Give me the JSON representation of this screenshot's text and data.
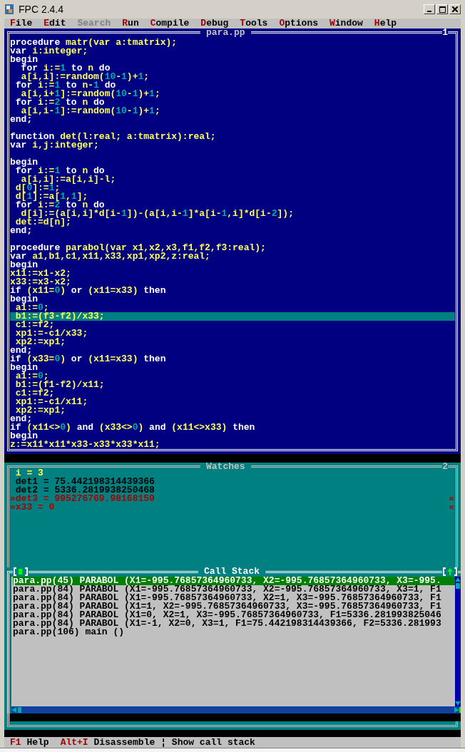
{
  "window": {
    "title": "FPC 2.4.4"
  },
  "menu": [
    {
      "hot": "F",
      "rest": "ile",
      "disabled": false
    },
    {
      "hot": "E",
      "rest": "dit",
      "disabled": false
    },
    {
      "hot": "S",
      "rest": "earch",
      "disabled": true
    },
    {
      "hot": "R",
      "rest": "un",
      "disabled": false
    },
    {
      "hot": "C",
      "rest": "ompile",
      "disabled": false
    },
    {
      "hot": "D",
      "rest": "ebug",
      "disabled": false
    },
    {
      "hot": "T",
      "rest": "ools",
      "disabled": false
    },
    {
      "hot": "O",
      "rest": "ptions",
      "disabled": false
    },
    {
      "hot": "W",
      "rest": "indow",
      "disabled": false
    },
    {
      "hot": "H",
      "rest": "elp",
      "disabled": false
    }
  ],
  "editor": {
    "title": "para.pp",
    "number": "1",
    "lines": [
      {
        "current": false,
        "seg": [
          {
            "kind": "keyword",
            "t": "procedure "
          },
          {
            "kind": "identifier",
            "t": "matr(var a:tmatrix);"
          }
        ]
      },
      {
        "current": false,
        "seg": [
          {
            "kind": "keyword",
            "t": "var "
          },
          {
            "kind": "identifier",
            "t": "i:integer;"
          }
        ]
      },
      {
        "current": false,
        "seg": [
          {
            "kind": "keyword",
            "t": "begin"
          }
        ]
      },
      {
        "current": false,
        "seg": [
          {
            "kind": "keyword",
            "t": "  for "
          },
          {
            "kind": "identifier",
            "t": "i:="
          },
          {
            "kind": "number",
            "t": "1"
          },
          {
            "kind": "keyword",
            "t": " to "
          },
          {
            "kind": "identifier",
            "t": "n"
          },
          {
            "kind": "keyword",
            "t": " do"
          }
        ]
      },
      {
        "current": false,
        "seg": [
          {
            "kind": "identifier",
            "t": "  a[i,i]:=random("
          },
          {
            "kind": "number",
            "t": "10"
          },
          {
            "kind": "identifier",
            "t": "-"
          },
          {
            "kind": "number",
            "t": "1"
          },
          {
            "kind": "identifier",
            "t": ")+"
          },
          {
            "kind": "number",
            "t": "1"
          },
          {
            "kind": "identifier",
            "t": ";"
          }
        ]
      },
      {
        "current": false,
        "seg": [
          {
            "kind": "keyword",
            "t": " for "
          },
          {
            "kind": "identifier",
            "t": "i:="
          },
          {
            "kind": "number",
            "t": "1"
          },
          {
            "kind": "keyword",
            "t": " to "
          },
          {
            "kind": "identifier",
            "t": "n-"
          },
          {
            "kind": "number",
            "t": "1"
          },
          {
            "kind": "keyword",
            "t": " do"
          }
        ]
      },
      {
        "current": false,
        "seg": [
          {
            "kind": "identifier",
            "t": "  a[i,i+"
          },
          {
            "kind": "number",
            "t": "1"
          },
          {
            "kind": "identifier",
            "t": "]:=random("
          },
          {
            "kind": "number",
            "t": "10"
          },
          {
            "kind": "identifier",
            "t": "-"
          },
          {
            "kind": "number",
            "t": "1"
          },
          {
            "kind": "identifier",
            "t": ")+"
          },
          {
            "kind": "number",
            "t": "1"
          },
          {
            "kind": "identifier",
            "t": ";"
          }
        ]
      },
      {
        "current": false,
        "seg": [
          {
            "kind": "keyword",
            "t": " for "
          },
          {
            "kind": "identifier",
            "t": "i:="
          },
          {
            "kind": "number",
            "t": "2"
          },
          {
            "kind": "keyword",
            "t": " to "
          },
          {
            "kind": "identifier",
            "t": "n"
          },
          {
            "kind": "keyword",
            "t": " do"
          }
        ]
      },
      {
        "current": false,
        "seg": [
          {
            "kind": "identifier",
            "t": "  a[i,i-"
          },
          {
            "kind": "number",
            "t": "1"
          },
          {
            "kind": "identifier",
            "t": "]:=random("
          },
          {
            "kind": "number",
            "t": "10"
          },
          {
            "kind": "identifier",
            "t": "-"
          },
          {
            "kind": "number",
            "t": "1"
          },
          {
            "kind": "identifier",
            "t": ")+"
          },
          {
            "kind": "number",
            "t": "1"
          },
          {
            "kind": "identifier",
            "t": ";"
          }
        ]
      },
      {
        "current": false,
        "seg": [
          {
            "kind": "keyword",
            "t": "end;"
          }
        ]
      },
      {
        "current": false
      },
      {
        "current": false,
        "seg": [
          {
            "kind": "keyword",
            "t": "function "
          },
          {
            "kind": "identifier",
            "t": "det(l:real; a:tmatrix):real;"
          }
        ]
      },
      {
        "current": false,
        "seg": [
          {
            "kind": "keyword",
            "t": "var "
          },
          {
            "kind": "identifier",
            "t": "i,j:integer;"
          }
        ]
      },
      {
        "current": false
      },
      {
        "current": false,
        "seg": [
          {
            "kind": "keyword",
            "t": "begin"
          }
        ]
      },
      {
        "current": false,
        "seg": [
          {
            "kind": "keyword",
            "t": " for "
          },
          {
            "kind": "identifier",
            "t": "i:="
          },
          {
            "kind": "number",
            "t": "1"
          },
          {
            "kind": "keyword",
            "t": " to "
          },
          {
            "kind": "identifier",
            "t": "n"
          },
          {
            "kind": "keyword",
            "t": " do"
          }
        ]
      },
      {
        "current": false,
        "seg": [
          {
            "kind": "identifier",
            "t": "  a[i,i]:=a[i,i]-l;"
          }
        ]
      },
      {
        "current": false,
        "seg": [
          {
            "kind": "identifier",
            "t": " d["
          },
          {
            "kind": "number",
            "t": "0"
          },
          {
            "kind": "identifier",
            "t": "]:="
          },
          {
            "kind": "number",
            "t": "1"
          },
          {
            "kind": "identifier",
            "t": ";"
          }
        ]
      },
      {
        "current": false,
        "seg": [
          {
            "kind": "identifier",
            "t": " d["
          },
          {
            "kind": "number",
            "t": "1"
          },
          {
            "kind": "identifier",
            "t": "]:=a["
          },
          {
            "kind": "number",
            "t": "1"
          },
          {
            "kind": "identifier",
            "t": ","
          },
          {
            "kind": "number",
            "t": "1"
          },
          {
            "kind": "identifier",
            "t": "];"
          }
        ]
      },
      {
        "current": false,
        "seg": [
          {
            "kind": "keyword",
            "t": " for "
          },
          {
            "kind": "identifier",
            "t": "i:="
          },
          {
            "kind": "number",
            "t": "2"
          },
          {
            "kind": "keyword",
            "t": " to "
          },
          {
            "kind": "identifier",
            "t": "n"
          },
          {
            "kind": "keyword",
            "t": " do"
          }
        ]
      },
      {
        "current": false,
        "seg": [
          {
            "kind": "identifier",
            "t": "  d[i]:=(a[i,i]*d[i-"
          },
          {
            "kind": "number",
            "t": "1"
          },
          {
            "kind": "identifier",
            "t": "])-(a[i,i-"
          },
          {
            "kind": "number",
            "t": "1"
          },
          {
            "kind": "identifier",
            "t": "]*a[i-"
          },
          {
            "kind": "number",
            "t": "1"
          },
          {
            "kind": "identifier",
            "t": ",i]*d[i-"
          },
          {
            "kind": "number",
            "t": "2"
          },
          {
            "kind": "identifier",
            "t": "]);"
          }
        ]
      },
      {
        "current": false,
        "seg": [
          {
            "kind": "identifier",
            "t": " det:=d[n];"
          }
        ]
      },
      {
        "current": false,
        "seg": [
          {
            "kind": "keyword",
            "t": "end;"
          }
        ]
      },
      {
        "current": false
      },
      {
        "current": false,
        "seg": [
          {
            "kind": "keyword",
            "t": "procedure "
          },
          {
            "kind": "identifier",
            "t": "parabol(var x1,x2,x3,f1,f2,f3:real);"
          }
        ]
      },
      {
        "current": false,
        "seg": [
          {
            "kind": "keyword",
            "t": "var "
          },
          {
            "kind": "identifier",
            "t": "a1,b1,c1,x11,x33,xp1,xp2,z:real;"
          }
        ]
      },
      {
        "current": false,
        "seg": [
          {
            "kind": "keyword",
            "t": "begin"
          }
        ]
      },
      {
        "current": false,
        "seg": [
          {
            "kind": "identifier",
            "t": "x11:=x1-x2;"
          }
        ]
      },
      {
        "current": false,
        "seg": [
          {
            "kind": "identifier",
            "t": "x33:=x3-x2;"
          }
        ]
      },
      {
        "current": false,
        "seg": [
          {
            "kind": "keyword",
            "t": "if "
          },
          {
            "kind": "identifier",
            "t": "(x11="
          },
          {
            "kind": "number",
            "t": "0"
          },
          {
            "kind": "identifier",
            "t": ") "
          },
          {
            "kind": "keyword",
            "t": "or "
          },
          {
            "kind": "identifier",
            "t": "(x11=x33) "
          },
          {
            "kind": "keyword",
            "t": "then"
          }
        ]
      },
      {
        "current": false,
        "seg": [
          {
            "kind": "keyword",
            "t": "begin"
          }
        ]
      },
      {
        "current": false,
        "seg": [
          {
            "kind": "identifier",
            "t": " a1:="
          },
          {
            "kind": "number",
            "t": "0"
          },
          {
            "kind": "identifier",
            "t": ";"
          }
        ]
      },
      {
        "current": true,
        "seg": [
          {
            "kind": "identifier",
            "t": " b1:=(f3-f2)/x33;"
          }
        ]
      },
      {
        "current": false,
        "seg": [
          {
            "kind": "identifier",
            "t": " c1:=f2;"
          }
        ]
      },
      {
        "current": false,
        "seg": [
          {
            "kind": "identifier",
            "t": " xp1:=-c1/x33;"
          }
        ]
      },
      {
        "current": false,
        "seg": [
          {
            "kind": "identifier",
            "t": " xp2:=xp1;"
          }
        ]
      },
      {
        "current": false,
        "seg": [
          {
            "kind": "keyword",
            "t": "end;"
          }
        ]
      },
      {
        "current": false,
        "seg": [
          {
            "kind": "keyword",
            "t": "if "
          },
          {
            "kind": "identifier",
            "t": "(x33="
          },
          {
            "kind": "number",
            "t": "0"
          },
          {
            "kind": "identifier",
            "t": ") "
          },
          {
            "kind": "keyword",
            "t": "or "
          },
          {
            "kind": "identifier",
            "t": "(x11=x33) "
          },
          {
            "kind": "keyword",
            "t": "then"
          }
        ]
      },
      {
        "current": false,
        "seg": [
          {
            "kind": "keyword",
            "t": "begin"
          }
        ]
      },
      {
        "current": false,
        "seg": [
          {
            "kind": "identifier",
            "t": " a1:="
          },
          {
            "kind": "number",
            "t": "0"
          },
          {
            "kind": "identifier",
            "t": ";"
          }
        ]
      },
      {
        "current": false,
        "seg": [
          {
            "kind": "identifier",
            "t": " b1:=(f1-f2)/x11;"
          }
        ]
      },
      {
        "current": false,
        "seg": [
          {
            "kind": "identifier",
            "t": " c1:=f2;"
          }
        ]
      },
      {
        "current": false,
        "seg": [
          {
            "kind": "identifier",
            "t": " xp1:=-c1/x11;"
          }
        ]
      },
      {
        "current": false,
        "seg": [
          {
            "kind": "identifier",
            "t": " xp2:=xp1;"
          }
        ]
      },
      {
        "current": false,
        "seg": [
          {
            "kind": "keyword",
            "t": "end;"
          }
        ]
      },
      {
        "current": false,
        "seg": [
          {
            "kind": "keyword",
            "t": "if "
          },
          {
            "kind": "identifier",
            "t": "(x11<>"
          },
          {
            "kind": "number",
            "t": "0"
          },
          {
            "kind": "identifier",
            "t": ") "
          },
          {
            "kind": "keyword",
            "t": "and "
          },
          {
            "kind": "identifier",
            "t": "(x33<>"
          },
          {
            "kind": "number",
            "t": "0"
          },
          {
            "kind": "identifier",
            "t": ") "
          },
          {
            "kind": "keyword",
            "t": "and "
          },
          {
            "kind": "identifier",
            "t": "(x11<>x33) "
          },
          {
            "kind": "keyword",
            "t": "then"
          }
        ]
      },
      {
        "current": false,
        "seg": [
          {
            "kind": "keyword",
            "t": "begin"
          }
        ]
      },
      {
        "current": false,
        "seg": [
          {
            "kind": "identifier",
            "t": "z:=x11*x11*x33-x33*x33*x11;"
          }
        ]
      }
    ]
  },
  "watches": {
    "title": "Watches",
    "number": "2",
    "items": [
      {
        "text": " i = 3",
        "selected": true,
        "changed": false
      },
      {
        "text": " det1 = 75.442198314439366",
        "selected": false,
        "changed": false
      },
      {
        "text": " det2 = 5336.2819938250468",
        "selected": false,
        "changed": false
      },
      {
        "text": "»det3 = 995276769.98168159",
        "flag": "«",
        "selected": false,
        "changed": true
      },
      {
        "text": "»x33 = 0",
        "flag": "«",
        "selected": false,
        "changed": true
      }
    ]
  },
  "call_stack": {
    "title": "Call Stack",
    "rows": [
      {
        "text": "para.pp(45) PARABOL (X1=-995.76857364960733, X2=-995.76857364960733, X3=-995.",
        "selected": true
      },
      {
        "text": "para.pp(84) PARABOL (X1=-995.76857364960733, X2=-995.76857364960733, X3=1, F1",
        "selected": false
      },
      {
        "text": "para.pp(84) PARABOL (X1=-995.76857364960733, X2=1, X3=-995.76857364960733, F1",
        "selected": false
      },
      {
        "text": "para.pp(84) PARABOL (X1=1, X2=-995.76857364960733, X3=-995.76857364960733, F1",
        "selected": false
      },
      {
        "text": "para.pp(84) PARABOL (X1=0, X2=1, X3=-995.76857364960733, F1=5336.281993825046",
        "selected": false
      },
      {
        "text": "para.pp(84) PARABOL (X1=-1, X2=0, X3=1, F1=75.442198314439366, F2=5336.281993",
        "selected": false
      },
      {
        "text": "para.pp(106) main ()",
        "selected": false
      }
    ]
  },
  "status_bar": {
    "keys": [
      {
        "key": "F1",
        "label": "Help"
      },
      {
        "key": "Alt+I",
        "label": "Disassemble"
      }
    ],
    "hint": "¦ Show call stack"
  }
}
